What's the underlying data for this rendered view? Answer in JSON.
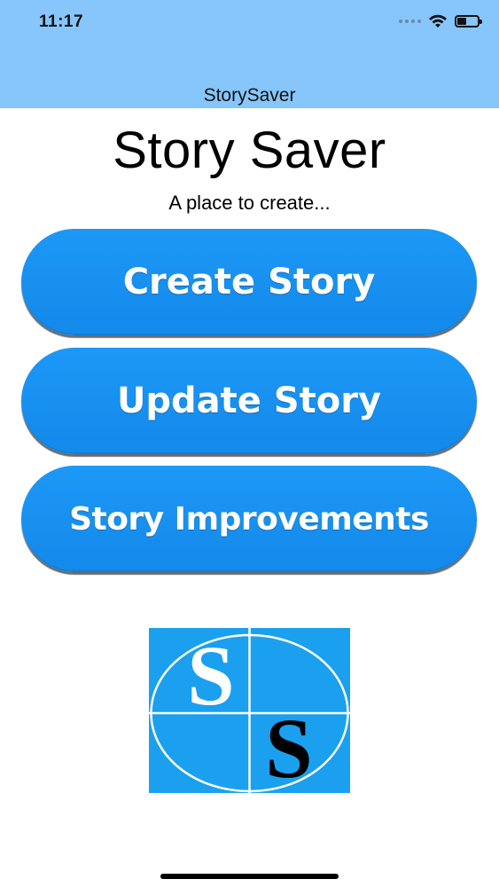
{
  "status_bar": {
    "time": "11:17",
    "battery_level": 0.45,
    "icons": [
      "signal-dots-icon",
      "wifi-icon",
      "battery-icon"
    ]
  },
  "nav": {
    "title": "StorySaver"
  },
  "main": {
    "title": "Story Saver",
    "subtitle": "A place to create...",
    "buttons": [
      {
        "label": "Create Story"
      },
      {
        "label": "Update Story"
      },
      {
        "label": "Story Improvements"
      }
    ]
  },
  "logo": {
    "letters": [
      "S",
      "S"
    ],
    "colors": {
      "background": "#1aa0ef",
      "lines": "#ffffff",
      "top_letter": "#ffffff",
      "bottom_letter": "#000000"
    }
  },
  "colors": {
    "header": "#86c6fb",
    "button": "#1a92f2",
    "button_text": "#ffffff"
  }
}
